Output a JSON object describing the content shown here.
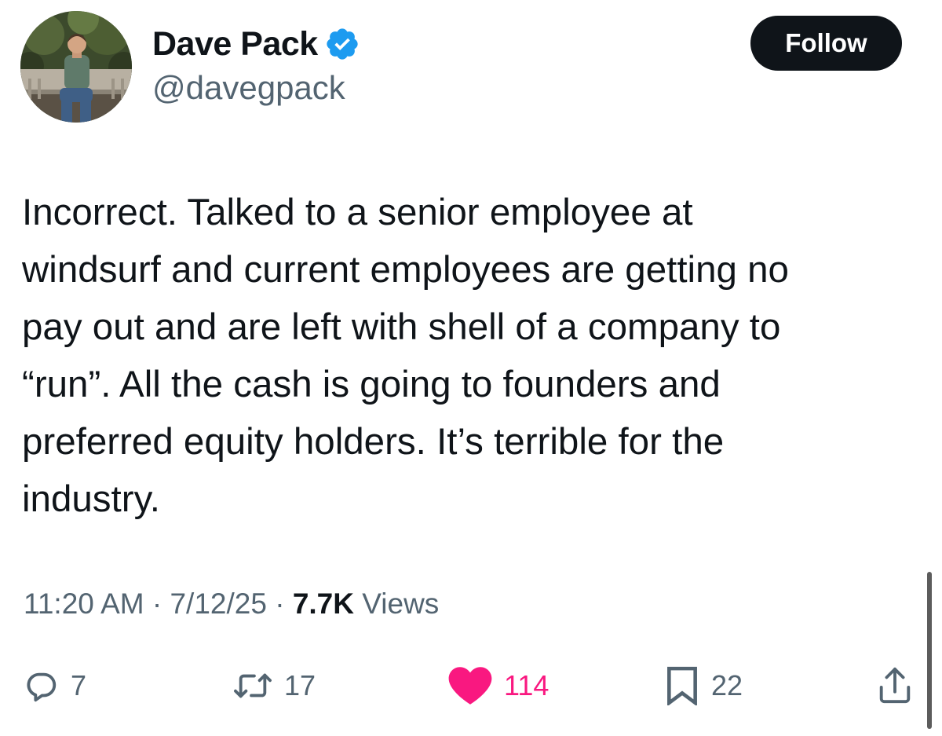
{
  "author": {
    "display_name": "Dave Pack",
    "handle": "@davegpack",
    "verified": true,
    "verified_color": "#1d9bf0"
  },
  "follow_label": "Follow",
  "tweet": {
    "lines": [
      "Incorrect. Talked to a senior employee at",
      "windsurf and current employees are getting no",
      "pay out and are left with shell of a company to",
      "“run”. All the cash is going to founders and",
      "preferred equity holders. It’s terrible for the",
      "industry."
    ]
  },
  "meta": {
    "time": "11:20 AM",
    "separator": "·",
    "date": "7/12/25",
    "views_count": "7.7K",
    "views_label": "Views"
  },
  "actions": {
    "replies": "7",
    "reposts": "17",
    "likes": "114",
    "bookmarks": "22",
    "liked": true,
    "like_color": "#f91880"
  },
  "icons": {
    "reply": "reply-icon",
    "repost": "repost-icon",
    "like": "heart-icon",
    "bookmark": "bookmark-icon",
    "share": "share-icon"
  }
}
